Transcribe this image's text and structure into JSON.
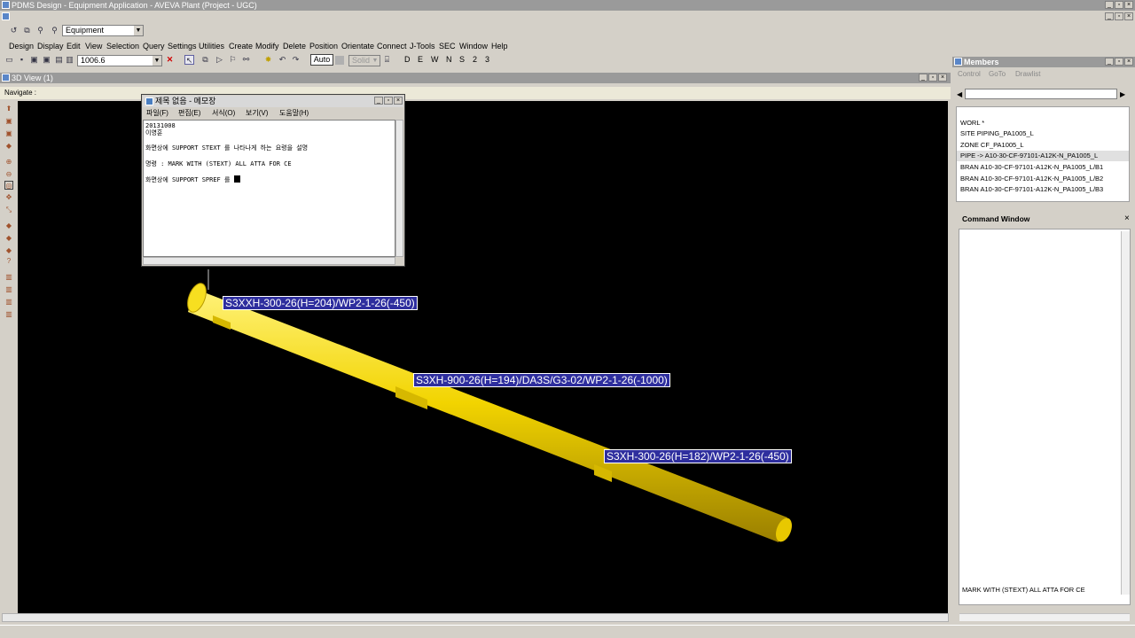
{
  "window": {
    "title": "PDMS Design - Equipment Application - AVEVA Plant (Project - UGC)"
  },
  "toolbar": {
    "application": "Equipment",
    "value": "1006.6",
    "auto_label": "Auto",
    "solid_label": "Solid",
    "directions": [
      "D",
      "E",
      "W",
      "N",
      "S",
      "2",
      "3"
    ]
  },
  "menu": [
    "Design",
    "Display",
    "Edit",
    "View",
    "Selection",
    "Query",
    "Settings",
    "Utilities",
    "Create",
    "Modify",
    "Delete",
    "Position",
    "Orientate",
    "Connect",
    "J-Tools",
    "SEC",
    "Window",
    "Help"
  ],
  "view": {
    "title": "3D View (1)",
    "navigate": "Navigate :"
  },
  "labels3d": [
    "S3XXH-300-26(H=204)/WP2-1-26(-450)",
    "S3XH-900-26(H=194)/DA3S/G3-02/WP2-1-26(-1000)",
    "S3XH-300-26(H=182)/WP2-1-26(-450)"
  ],
  "notepad": {
    "title": "제목 없음 - 메모장",
    "menu": [
      "파일(F)",
      "편집(E)",
      "서식(O)",
      "보기(V)",
      "도움말(H)"
    ],
    "lines": [
      "20131008",
      "이영훈",
      "화면상에 SUPPORT STEXT 를 나타나게 하는 요령을 설명",
      "명령 : MARK WITH (STEXT) ALL ATTA FOR CE",
      "화면상에 SUPPORT SPREF 를"
    ]
  },
  "members": {
    "title": "Members",
    "tabs": [
      "Control",
      "GoTo",
      "Drawlist"
    ],
    "items": [
      "WORL   *",
      "SITE   PIPING_PA1005_L",
      "ZONE   CF_PA1005_L",
      "PIPE -> A10-30-CF-97101-A12K-N_PA1005_L",
      "BRAN    A10-30-CF-97101-A12K-N_PA1005_L/B1",
      "BRAN    A10-30-CF-97101-A12K-N_PA1005_L/B2",
      "BRAN    A10-30-CF-97101-A12K-N_PA1005_L/B3"
    ],
    "selected_index": 3
  },
  "command_window": {
    "title": "Command Window",
    "input": "MARK WITH (STEXT) ALL ATTA FOR CE"
  },
  "colors": {
    "pipe": "#f2d400",
    "label_bg": "#2e2e9e",
    "viewport_bg": "#000000"
  }
}
